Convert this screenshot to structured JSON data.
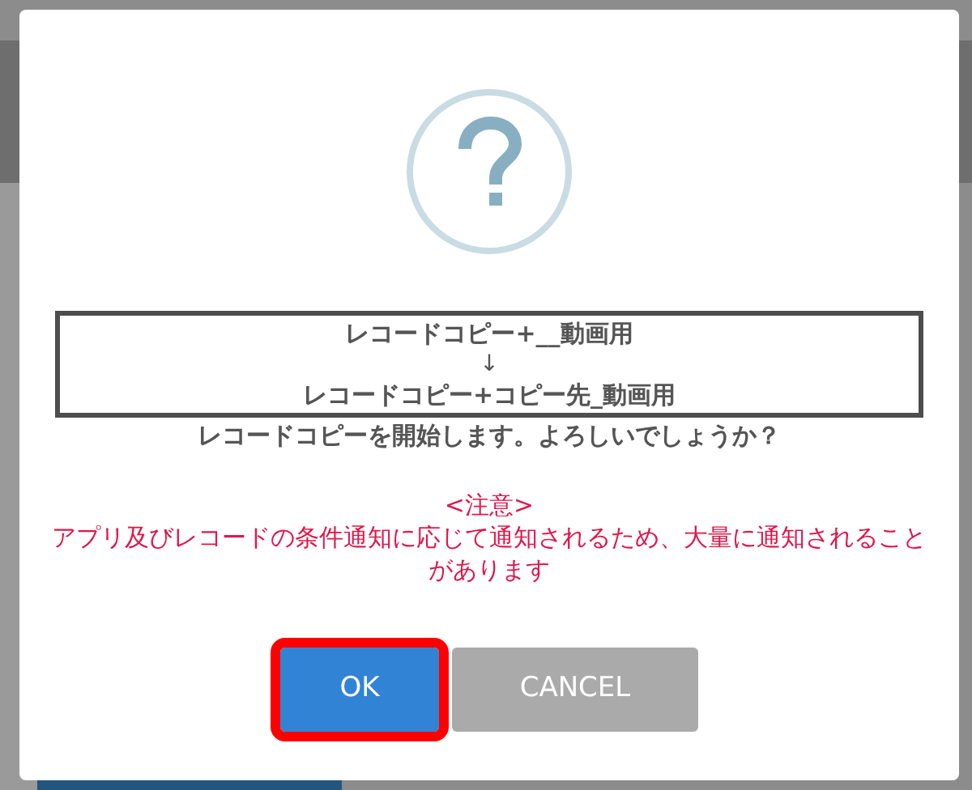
{
  "dialog": {
    "copy_box": {
      "source": "レコードコピー+__動画用",
      "arrow": "↓",
      "destination": "レコードコピー+コピー先_動画用"
    },
    "message": "レコードコピーを開始します。よろしいでしょうか？",
    "notice": {
      "title": "<注意>",
      "body": "アプリ及びレコードの条件通知に応じて通知されるため、大量に通知されることがあります"
    },
    "buttons": [
      {
        "label": "OK",
        "kind": "primary",
        "highlighted": true
      },
      {
        "label": "CANCEL",
        "kind": "secondary",
        "highlighted": false
      }
    ]
  }
}
